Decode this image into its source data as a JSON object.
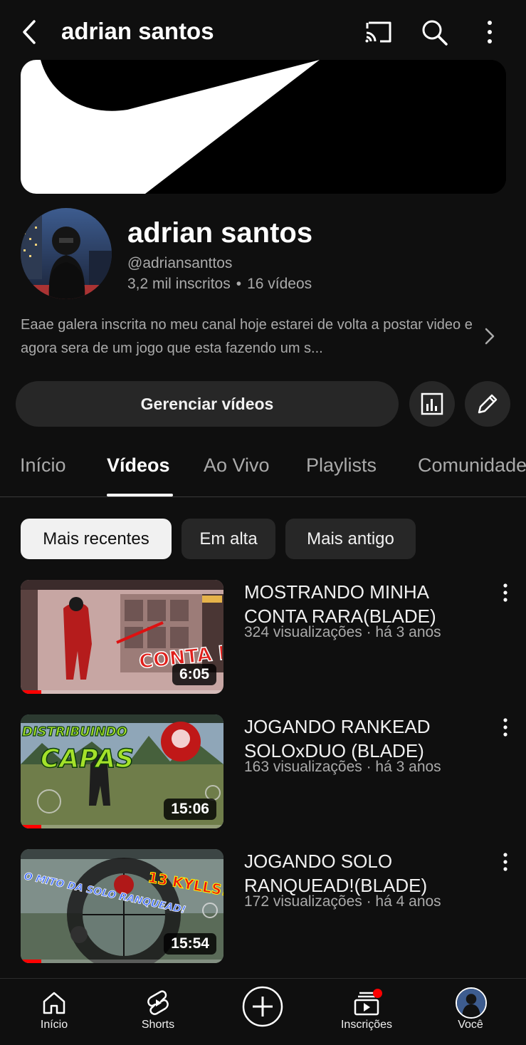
{
  "header": {
    "title": "adrian santos",
    "icons": [
      "back-arrow-icon",
      "cast-icon",
      "search-icon",
      "more-vert-icon"
    ]
  },
  "channel": {
    "name": "adrian santos",
    "handle": "@adriansanttos",
    "subscribers": "3,2 mil inscritos",
    "stats_separator": "•",
    "video_count": "16 vídeos",
    "description": "Eaae galera inscrita no meu canal hoje estarei de volta a postar video e agora sera de um jogo que esta fazendo um s..."
  },
  "actions": {
    "manage_videos": "Gerenciar vídeos",
    "icons": [
      "analytics-icon",
      "edit-pencil-icon"
    ]
  },
  "tabs": [
    {
      "label": "Início",
      "active": false
    },
    {
      "label": "Vídeos",
      "active": true
    },
    {
      "label": "Ao Vivo",
      "active": false
    },
    {
      "label": "Playlists",
      "active": false
    },
    {
      "label": "Comunidade",
      "active": false
    }
  ],
  "chips": [
    {
      "label": "Mais recentes",
      "active": true
    },
    {
      "label": "Em alta",
      "active": false
    },
    {
      "label": "Mais antigo",
      "active": false
    }
  ],
  "videos": [
    {
      "title": "MOSTRANDO MINHA CONTA RARA(BLADE)",
      "meta": "324 visualizações · há 3 anos",
      "duration": "6:05",
      "thumb_text": "CONTA RARA",
      "watched_fraction": 0.1
    },
    {
      "title": "JOGANDO RANKEAD SOLOxDUO (BLADE)",
      "meta": "163 visualizações · há 3 anos",
      "duration": "15:06",
      "thumb_text": "DISTRIBUINDO CAPAS",
      "watched_fraction": 0.1
    },
    {
      "title": "JOGANDO SOLO RANQUEAD!(BLADE)",
      "meta": "172 visualizações · há 4 anos",
      "duration": "15:54",
      "thumb_text_1": "O MITO DA SOLO RANQUEAD!",
      "thumb_text_2": "13 KYLLS!",
      "watched_fraction": 0.1
    }
  ],
  "bottom_nav": [
    {
      "label": "Início",
      "icon": "home-icon"
    },
    {
      "label": "Shorts",
      "icon": "shorts-icon"
    },
    {
      "label": "",
      "icon": "create-plus-icon"
    },
    {
      "label": "Inscrições",
      "icon": "subscriptions-icon",
      "notification": true
    },
    {
      "label": "Você",
      "icon": "avatar"
    }
  ],
  "colors": {
    "background": "#0f0f0f",
    "surface": "#272727",
    "text_primary": "#f1f1f1",
    "text_secondary": "#aaaaaa",
    "accent_red": "#ff0000"
  }
}
